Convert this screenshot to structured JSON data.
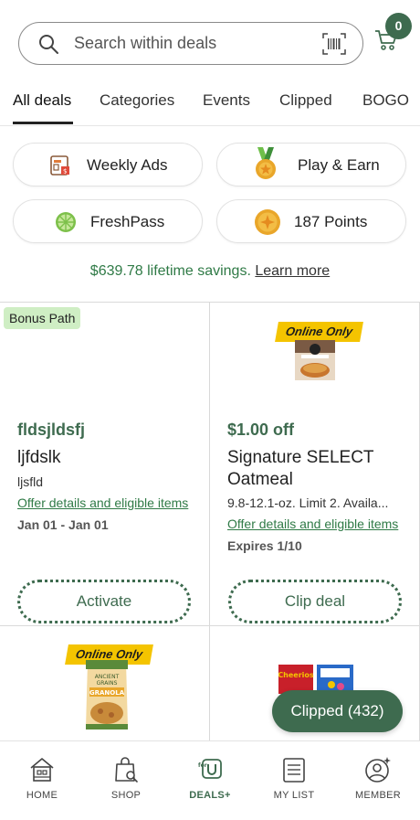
{
  "search": {
    "placeholder": "Search within deals"
  },
  "cart": {
    "count": "0"
  },
  "tabs": [
    {
      "label": "All deals",
      "active": true
    },
    {
      "label": "Categories"
    },
    {
      "label": "Events"
    },
    {
      "label": "Clipped"
    },
    {
      "label": "BOGO"
    }
  ],
  "quick_links": {
    "weekly_ads": "Weekly Ads",
    "play_earn": "Play & Earn",
    "freshpass": "FreshPass",
    "points": "187 Points"
  },
  "savings": {
    "amount": "$639.78 lifetime savings.",
    "link": "Learn more"
  },
  "offers": [
    {
      "badge": "Bonus Path",
      "title": "fldsjldsfj",
      "name": "ljfdslk",
      "desc": "ljsfld",
      "link": "Offer details and eligible items",
      "date": "Jan 01 - Jan 01",
      "button": "Activate"
    },
    {
      "tag": "Online Only",
      "title": "$1.00 off",
      "name": "Signature SELECT Oatmeal",
      "desc": "9.8-12.1-oz. Limit 2. Availa...",
      "link": "Offer details and eligible items",
      "date": "Expires 1/10",
      "button": "Clip deal"
    },
    {
      "tag": "Online Only"
    }
  ],
  "clipped_button": "Clipped (432)",
  "bottom_nav": [
    {
      "label": "HOME"
    },
    {
      "label": "SHOP"
    },
    {
      "label": "DEALS+",
      "active": true
    },
    {
      "label": "MY LIST"
    },
    {
      "label": "MEMBER"
    }
  ],
  "colors": {
    "brand_green": "#3e6b4f",
    "savings_green": "#2f7a46",
    "online_tag": "#f4c400",
    "bonus_tag": "#cfeec4"
  }
}
